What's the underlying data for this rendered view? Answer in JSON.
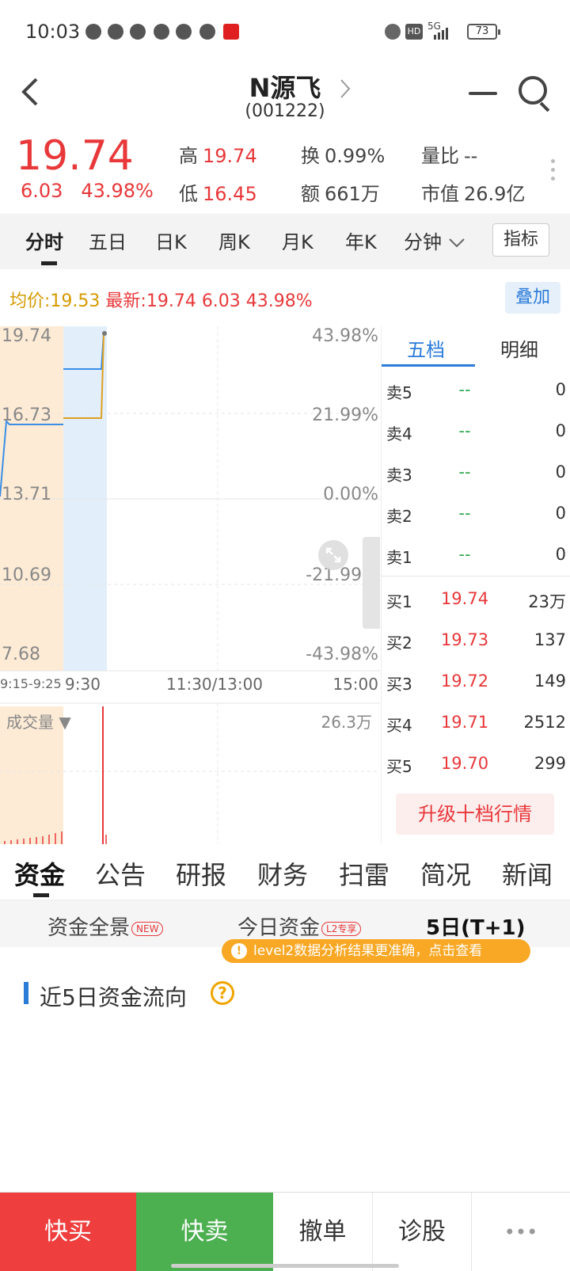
{
  "status_bar": {
    "time": "10:03",
    "network": "5G",
    "battery": "73"
  },
  "header": {
    "name": "N源飞",
    "code": "(001222)"
  },
  "quote": {
    "price": "19.74",
    "change": "6.03",
    "change_pct": "43.98%",
    "high_label": "高",
    "high": "19.74",
    "low_label": "低",
    "low": "16.45",
    "turnover_label": "换",
    "turnover": "0.99%",
    "amount_label": "额",
    "amount": "661万",
    "volume_ratio_label": "量比",
    "volume_ratio": "--",
    "market_cap_label": "市值",
    "market_cap": "26.9亿"
  },
  "period_tabs": [
    "分时",
    "五日",
    "日K",
    "周K",
    "月K",
    "年K",
    "分钟"
  ],
  "indicator_label": "指标",
  "avg_line": {
    "avg_label": "均价:",
    "avg_value": "19.53",
    "latest_label": "最新:",
    "latest_value": "19.74",
    "change": "6.03",
    "change_pct": "43.98%",
    "overlay_label": "叠加"
  },
  "chart": {
    "y_left": [
      "19.74",
      "16.73",
      "13.71",
      "10.69",
      "7.68"
    ],
    "y_right": [
      "43.98%",
      "21.99%",
      "0.00%",
      "-21.99%",
      "-43.98%"
    ],
    "x_labels": [
      "9:15-9:25",
      "9:30",
      "11:30/13:00",
      "15:00"
    ],
    "volume_label": "成交量",
    "volume_max": "26.3万"
  },
  "orderbook": {
    "tabs": [
      "五档",
      "明细"
    ],
    "sell": [
      {
        "label": "卖5",
        "price": "--",
        "vol": "0"
      },
      {
        "label": "卖4",
        "price": "--",
        "vol": "0"
      },
      {
        "label": "卖3",
        "price": "--",
        "vol": "0"
      },
      {
        "label": "卖2",
        "price": "--",
        "vol": "0"
      },
      {
        "label": "卖1",
        "price": "--",
        "vol": "0"
      }
    ],
    "buy": [
      {
        "label": "买1",
        "price": "19.74",
        "vol": "23万"
      },
      {
        "label": "买2",
        "price": "19.73",
        "vol": "137"
      },
      {
        "label": "买3",
        "price": "19.72",
        "vol": "149"
      },
      {
        "label": "买4",
        "price": "19.71",
        "vol": "2512"
      },
      {
        "label": "买5",
        "price": "19.70",
        "vol": "299"
      }
    ],
    "upgrade_label": "升级十档行情"
  },
  "info_tabs": [
    "资金",
    "公告",
    "研报",
    "财务",
    "扫雷",
    "简况",
    "新闻"
  ],
  "fund_tabs": {
    "overview": "资金全景",
    "overview_badge": "NEW",
    "today": "今日资金",
    "today_badge": "L2专享",
    "five_day": "5日(T+1)"
  },
  "l2_banner": "level2数据分析结果更准确，点击查看",
  "section_title": "近5日资金流向",
  "bottom_bar": {
    "buy": "快买",
    "sell": "快卖",
    "cancel": "撤单",
    "diagnose": "诊股",
    "more": "•••"
  },
  "colors": {
    "up": "#e8383a",
    "down": "#2fa84f",
    "accent": "#2b7bd8",
    "buy_btn": "#ee3e3e",
    "sell_btn": "#4caf50"
  }
}
